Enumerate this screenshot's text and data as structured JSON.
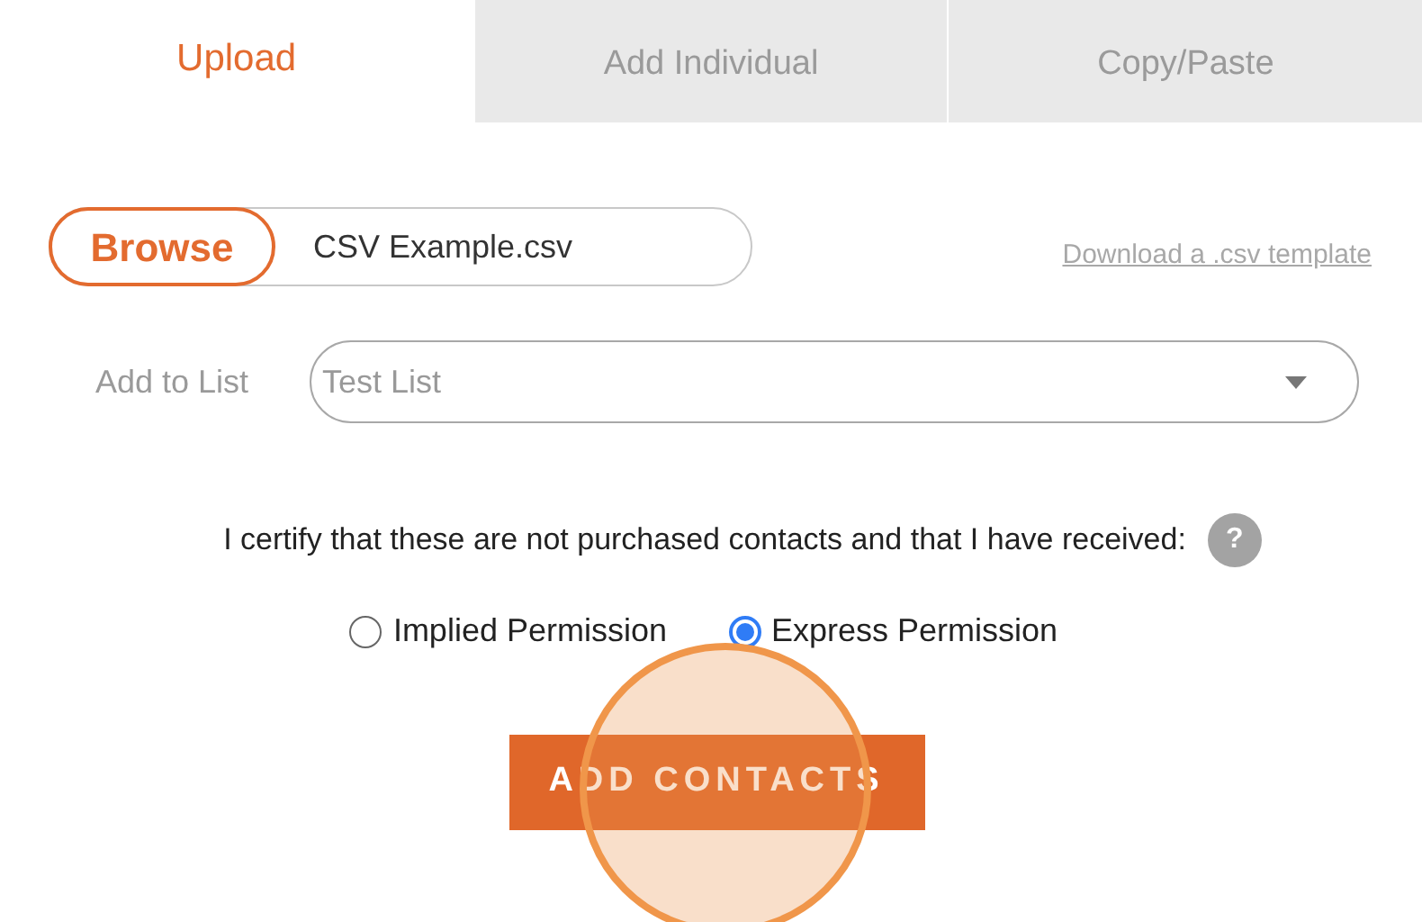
{
  "tabs": [
    {
      "label": "Upload",
      "selected": true
    },
    {
      "label": "Add Individual",
      "selected": false
    },
    {
      "label": "Copy/Paste",
      "selected": false
    }
  ],
  "file_picker": {
    "button": "Browse",
    "value": "CSV Example.csv"
  },
  "template_link": "Download a .csv template",
  "list_select": {
    "label": "Add to List",
    "value": "Test List"
  },
  "certify": {
    "text": "I certify that these are not purchased contacts and that I have received:",
    "help": "?"
  },
  "permissions": [
    {
      "label": "Implied Permission",
      "selected": false
    },
    {
      "label": "Express Permission",
      "selected": true
    }
  ],
  "submit_button": "ADD CONTACTS"
}
